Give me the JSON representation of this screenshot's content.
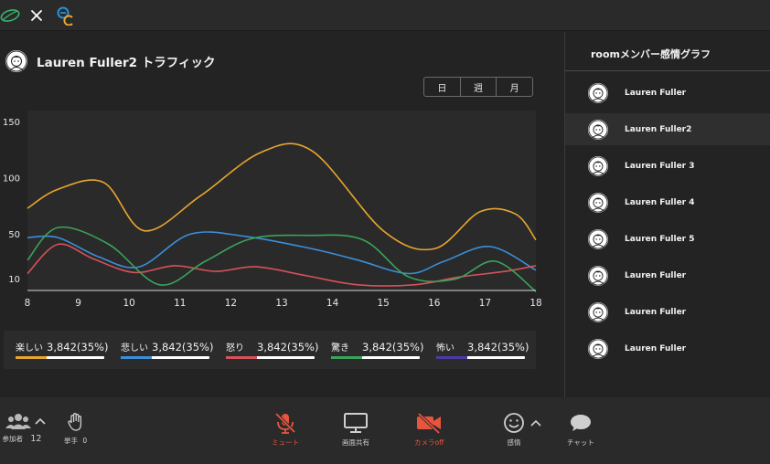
{
  "topbar": {
    "logo_icon": "leaf-logo-icon",
    "close_icon": "close-icon",
    "app_icon": "ec-logo-icon"
  },
  "main": {
    "title": "Lauren Fuller2 トラフィック",
    "periods": [
      "日",
      "週",
      "月"
    ]
  },
  "chart_data": {
    "type": "line",
    "x": [
      8,
      9,
      10,
      11,
      12,
      13,
      14,
      15,
      16,
      17,
      18
    ],
    "xticks": [
      "8",
      "9",
      "10",
      "11",
      "12",
      "13",
      "14",
      "15",
      "16",
      "17",
      "18"
    ],
    "yticks": [
      {
        "label": "150",
        "value": 150
      },
      {
        "label": "100",
        "value": 100
      },
      {
        "label": "50",
        "value": 50
      },
      {
        "label": "10",
        "value": 10
      }
    ],
    "ylim": [
      0,
      160
    ],
    "grid": false,
    "series": [
      {
        "name": "楽しい",
        "color": "#e8a62e",
        "x": [
          8,
          8.6,
          9.5,
          10.3,
          11.4,
          12.6,
          13.6,
          15,
          16,
          16.9,
          17.6,
          18
        ],
        "values": [
          73,
          90,
          96,
          53,
          84,
          123,
          124,
          53,
          37,
          70,
          68,
          45
        ]
      },
      {
        "name": "悲しい",
        "color": "#3b8fd9",
        "x": [
          8,
          8.6,
          9.4,
          10.2,
          11.2,
          12.3,
          13.6,
          14.5,
          15.5,
          16.2,
          17.1,
          18
        ],
        "values": [
          47,
          47,
          30,
          21,
          50,
          48,
          37,
          27,
          15,
          26,
          39,
          18
        ]
      },
      {
        "name": "怒り",
        "color": "#d6525a",
        "x": [
          8,
          8.6,
          9.3,
          10.1,
          10.9,
          11.7,
          12.5,
          13.5,
          14.5,
          15.6,
          16.5,
          17.4,
          18
        ],
        "values": [
          15,
          41,
          28,
          16,
          22,
          17,
          21,
          13,
          5,
          5,
          12,
          17,
          22
        ]
      },
      {
        "name": "驚き",
        "color": "#3aa45a",
        "x": [
          8,
          8.6,
          9.6,
          10.6,
          11.5,
          12.4,
          13.5,
          14.6,
          15.5,
          16.4,
          17.2,
          18
        ],
        "values": [
          27,
          56,
          41,
          5,
          26,
          46,
          49,
          45,
          12,
          10,
          26,
          -1
        ]
      }
    ]
  },
  "legend": [
    {
      "label": "楽しい",
      "value": "3,842(35%)",
      "color": "#e8a62e",
      "percent": 35
    },
    {
      "label": "悲しい",
      "value": "3,842(35%)",
      "color": "#3b8fd9",
      "percent": 35
    },
    {
      "label": "怒り",
      "value": "3,842(35%)",
      "color": "#d6525a",
      "percent": 35
    },
    {
      "label": "驚き",
      "value": "3,842(35%)",
      "color": "#3aa45a",
      "percent": 35
    },
    {
      "label": "怖い",
      "value": "3,842(35%)",
      "color": "#4a3aa6",
      "percent": 35
    }
  ],
  "sidebar": {
    "title": "roomメンバー感情グラフ",
    "members": [
      {
        "name": "Lauren Fuller",
        "active": false
      },
      {
        "name": "Lauren Fuller2",
        "active": true
      },
      {
        "name": "Lauren Fuller 3",
        "active": false
      },
      {
        "name": "Lauren Fuller 4",
        "active": false
      },
      {
        "name": "Lauren Fuller 5",
        "active": false
      },
      {
        "name": "Lauren Fuller",
        "active": false
      },
      {
        "name": "Lauren Fuller",
        "active": false
      },
      {
        "name": "Lauren Fuller",
        "active": false
      }
    ]
  },
  "toolbar": {
    "participants_label": "参加者",
    "participants_count": "12",
    "hand_label": "挙手",
    "hand_count": "0",
    "mute_label": "ミュート",
    "screen_share_label": "画面共有",
    "camera_label": "カメラoff",
    "emotion_label": "感情",
    "chat_label": "チャット",
    "accent_red": "#e8553e"
  }
}
